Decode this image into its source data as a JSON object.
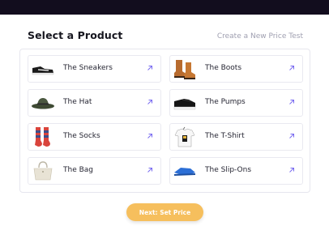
{
  "header": {
    "title": "Select a Product",
    "create_link": "Create a New Price Test"
  },
  "products": [
    {
      "label": "The Sneakers",
      "icon": "sneakers-icon"
    },
    {
      "label": "The Boots",
      "icon": "boots-icon"
    },
    {
      "label": "The Hat",
      "icon": "hat-icon"
    },
    {
      "label": "The Pumps",
      "icon": "pumps-icon"
    },
    {
      "label": "The Socks",
      "icon": "socks-icon"
    },
    {
      "label": "The T-Shirt",
      "icon": "tshirt-icon"
    },
    {
      "label": "The Bag",
      "icon": "bag-icon"
    },
    {
      "label": "The Slip-Ons",
      "icon": "slipons-icon"
    }
  ],
  "footer": {
    "next_label": "Next: Set Price"
  },
  "colors": {
    "accent": "#7a6cf0",
    "button": "#f6bf5d",
    "topbar": "#120d1e"
  }
}
